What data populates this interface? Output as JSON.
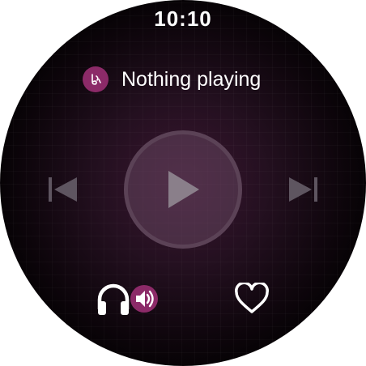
{
  "status_bar": {
    "time": "10:10"
  },
  "now_playing": {
    "label": "Nothing playing",
    "app_icon": "music-app-icon"
  },
  "controls": {
    "previous_icon": "skip-previous-icon",
    "play_icon": "play-icon",
    "next_icon": "skip-next-icon"
  },
  "bottom_actions": {
    "output_icon": "headphones-volume-icon",
    "like_icon": "heart-outline-icon"
  },
  "colors": {
    "accent": "#8c2a68",
    "disabled_control": "#5e5560",
    "play_ring": "#5b4256"
  }
}
